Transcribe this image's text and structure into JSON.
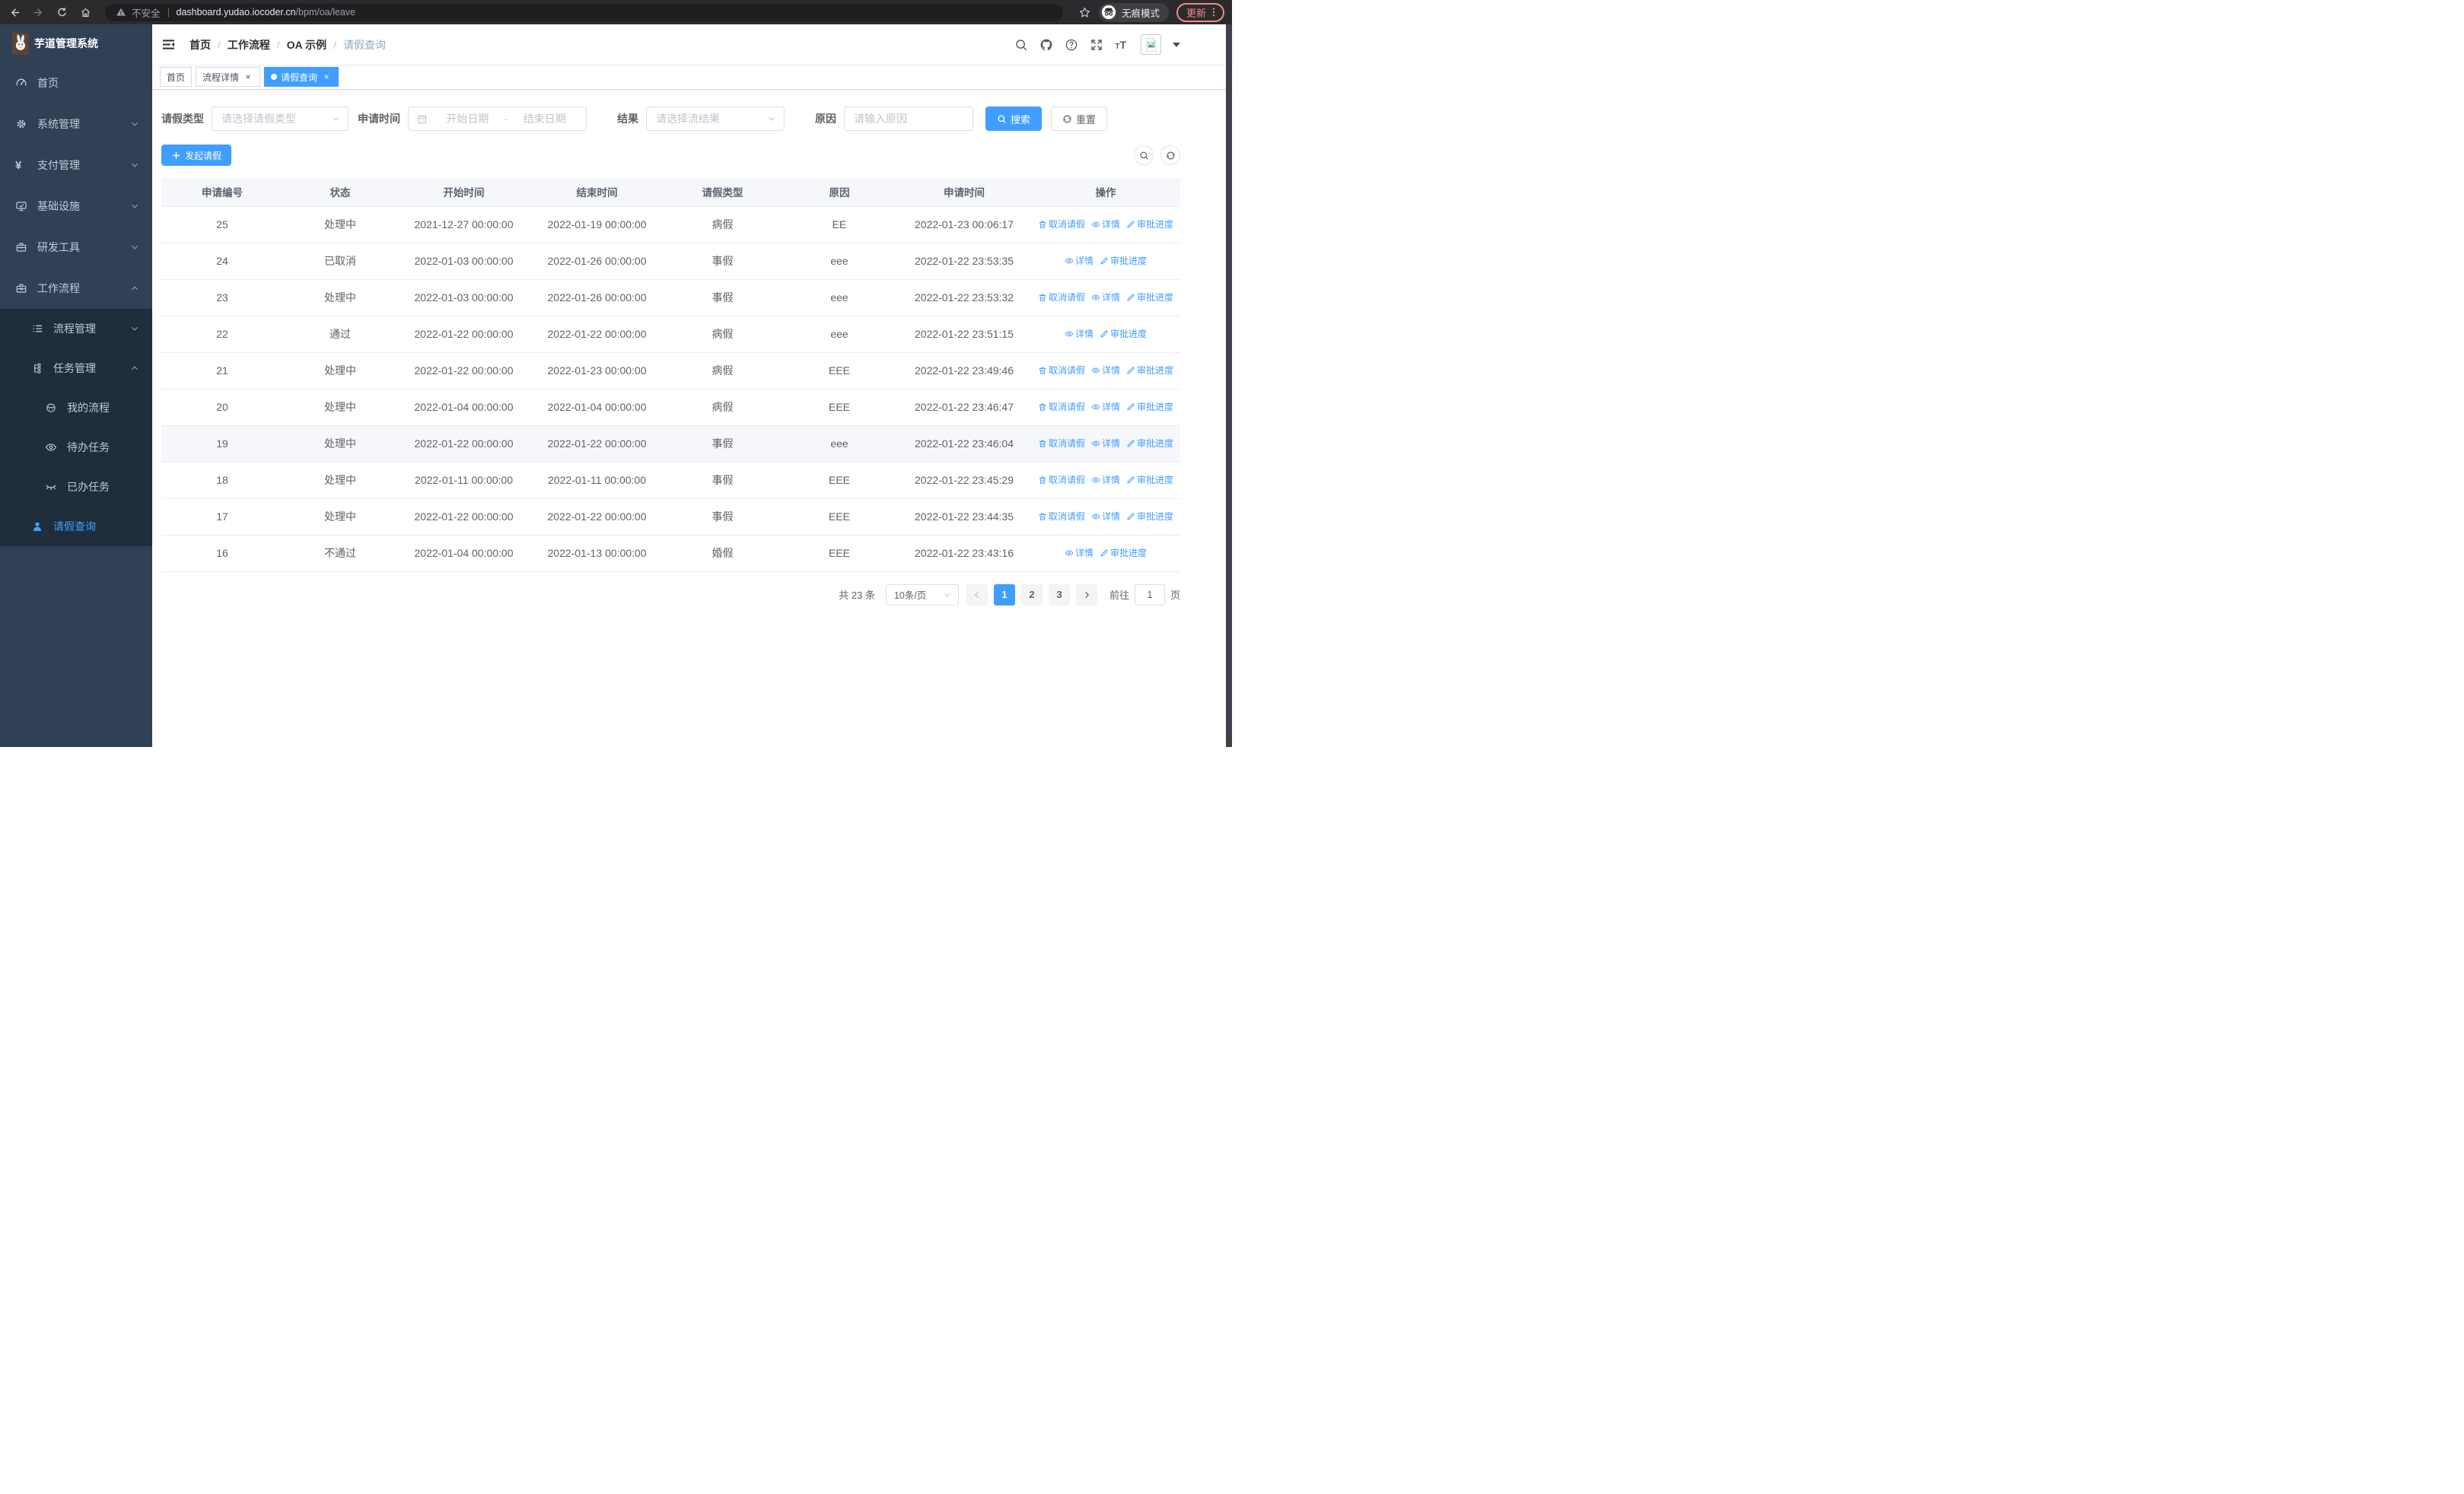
{
  "browser": {
    "security_label": "不安全",
    "url_host": "dashboard.yudao.iocoder.cn",
    "url_path": "/bpm/oa/leave",
    "incognito_label": "无痕模式",
    "update_label": "更新"
  },
  "sidebar": {
    "app_title": "芋道管理系统",
    "menu": [
      {
        "name": "home",
        "label": "首页",
        "icon": "dashboard-icon",
        "level": 1
      },
      {
        "name": "system",
        "label": "系统管理",
        "icon": "gear-icon",
        "level": 1,
        "chevron": "down"
      },
      {
        "name": "payment",
        "label": "支付管理",
        "icon": "yen-icon",
        "level": 1,
        "chevron": "down"
      },
      {
        "name": "infra",
        "label": "基础设施",
        "icon": "monitor-icon",
        "level": 1,
        "chevron": "down"
      },
      {
        "name": "devtools",
        "label": "研发工具",
        "icon": "toolbox-icon",
        "level": 1,
        "chevron": "down"
      },
      {
        "name": "workflow",
        "label": "工作流程",
        "icon": "briefcase-icon",
        "level": 1,
        "chevron": "up"
      },
      {
        "name": "process-mgmt",
        "label": "流程管理",
        "icon": "list-icon",
        "level": 2,
        "chevron": "down",
        "sub": true
      },
      {
        "name": "task-mgmt",
        "label": "任务管理",
        "icon": "tree-icon",
        "level": 2,
        "chevron": "up",
        "sub": true
      },
      {
        "name": "my-process",
        "label": "我的流程",
        "icon": "robot-icon",
        "level": 3,
        "sub": true
      },
      {
        "name": "todo-tasks",
        "label": "待办任务",
        "icon": "eye-icon",
        "level": 3,
        "sub": true
      },
      {
        "name": "done-tasks",
        "label": "已办任务",
        "icon": "eye-closed-icon",
        "level": 3,
        "sub": true
      },
      {
        "name": "leave-query",
        "label": "请假查询",
        "icon": "user-icon",
        "level": 2,
        "sub": true,
        "active": true
      }
    ]
  },
  "navbar": {
    "breadcrumb": [
      "首页",
      "工作流程",
      "OA 示例",
      "请假查询"
    ]
  },
  "tags": [
    {
      "label": "首页"
    },
    {
      "label": "流程详情",
      "closable": true
    },
    {
      "label": "请假查询",
      "closable": true,
      "active": true
    }
  ],
  "filters": {
    "leave_type_label": "请假类型",
    "leave_type_placeholder": "请选择请假类型",
    "apply_time_label": "申请时间",
    "start_placeholder": "开始日期",
    "range_separator": "-",
    "end_placeholder": "结束日期",
    "result_label": "结果",
    "result_placeholder": "请选择流结果",
    "reason_label": "原因",
    "reason_placeholder": "请输入原因",
    "search_label": "搜索",
    "reset_label": "重置"
  },
  "toolbar": {
    "create_label": "发起请假"
  },
  "table": {
    "headers": [
      "申请编号",
      "状态",
      "开始时间",
      "结束时间",
      "请假类型",
      "原因",
      "申请时间",
      "操作"
    ],
    "action_labels": {
      "cancel": "取消请假",
      "detail": "详情",
      "progress": "审批进度"
    },
    "rows": [
      {
        "id": "25",
        "status": "处理中",
        "start": "2021-12-27 00:00:00",
        "end": "2022-01-19 00:00:00",
        "type": "病假",
        "reason": "EE",
        "applied": "2022-01-23 00:06:17",
        "actions": [
          "cancel",
          "detail",
          "progress"
        ]
      },
      {
        "id": "24",
        "status": "已取消",
        "start": "2022-01-03 00:00:00",
        "end": "2022-01-26 00:00:00",
        "type": "事假",
        "reason": "eee",
        "applied": "2022-01-22 23:53:35",
        "actions": [
          "detail",
          "progress"
        ]
      },
      {
        "id": "23",
        "status": "处理中",
        "start": "2022-01-03 00:00:00",
        "end": "2022-01-26 00:00:00",
        "type": "事假",
        "reason": "eee",
        "applied": "2022-01-22 23:53:32",
        "actions": [
          "cancel",
          "detail",
          "progress"
        ]
      },
      {
        "id": "22",
        "status": "通过",
        "start": "2022-01-22 00:00:00",
        "end": "2022-01-22 00:00:00",
        "type": "病假",
        "reason": "eee",
        "applied": "2022-01-22 23:51:15",
        "actions": [
          "detail",
          "progress"
        ]
      },
      {
        "id": "21",
        "status": "处理中",
        "start": "2022-01-22 00:00:00",
        "end": "2022-01-23 00:00:00",
        "type": "病假",
        "reason": "EEE",
        "applied": "2022-01-22 23:49:46",
        "actions": [
          "cancel",
          "detail",
          "progress"
        ]
      },
      {
        "id": "20",
        "status": "处理中",
        "start": "2022-01-04 00:00:00",
        "end": "2022-01-04 00:00:00",
        "type": "病假",
        "reason": "EEE",
        "applied": "2022-01-22 23:46:47",
        "actions": [
          "cancel",
          "detail",
          "progress"
        ]
      },
      {
        "id": "19",
        "status": "处理中",
        "start": "2022-01-22 00:00:00",
        "end": "2022-01-22 00:00:00",
        "type": "事假",
        "reason": "eee",
        "applied": "2022-01-22 23:46:04",
        "actions": [
          "cancel",
          "detail",
          "progress"
        ],
        "hover": true
      },
      {
        "id": "18",
        "status": "处理中",
        "start": "2022-01-11 00:00:00",
        "end": "2022-01-11 00:00:00",
        "type": "事假",
        "reason": "EEE",
        "applied": "2022-01-22 23:45:29",
        "actions": [
          "cancel",
          "detail",
          "progress"
        ]
      },
      {
        "id": "17",
        "status": "处理中",
        "start": "2022-01-22 00:00:00",
        "end": "2022-01-22 00:00:00",
        "type": "事假",
        "reason": "EEE",
        "applied": "2022-01-22 23:44:35",
        "actions": [
          "cancel",
          "detail",
          "progress"
        ]
      },
      {
        "id": "16",
        "status": "不通过",
        "start": "2022-01-04 00:00:00",
        "end": "2022-01-13 00:00:00",
        "type": "婚假",
        "reason": "EEE",
        "applied": "2022-01-22 23:43:16",
        "actions": [
          "detail",
          "progress"
        ]
      }
    ]
  },
  "pagination": {
    "total_label": "共 23 条",
    "page_size_label": "10条/页",
    "pages": [
      "1",
      "2",
      "3"
    ],
    "active_page": "1",
    "goto_label": "前往",
    "goto_value": "1",
    "goto_suffix": "页"
  },
  "colors": {
    "primary": "#409eff",
    "sidebar_bg": "#304156",
    "submenu_bg": "#1f2d3d",
    "update_accent": "#f28b82"
  }
}
